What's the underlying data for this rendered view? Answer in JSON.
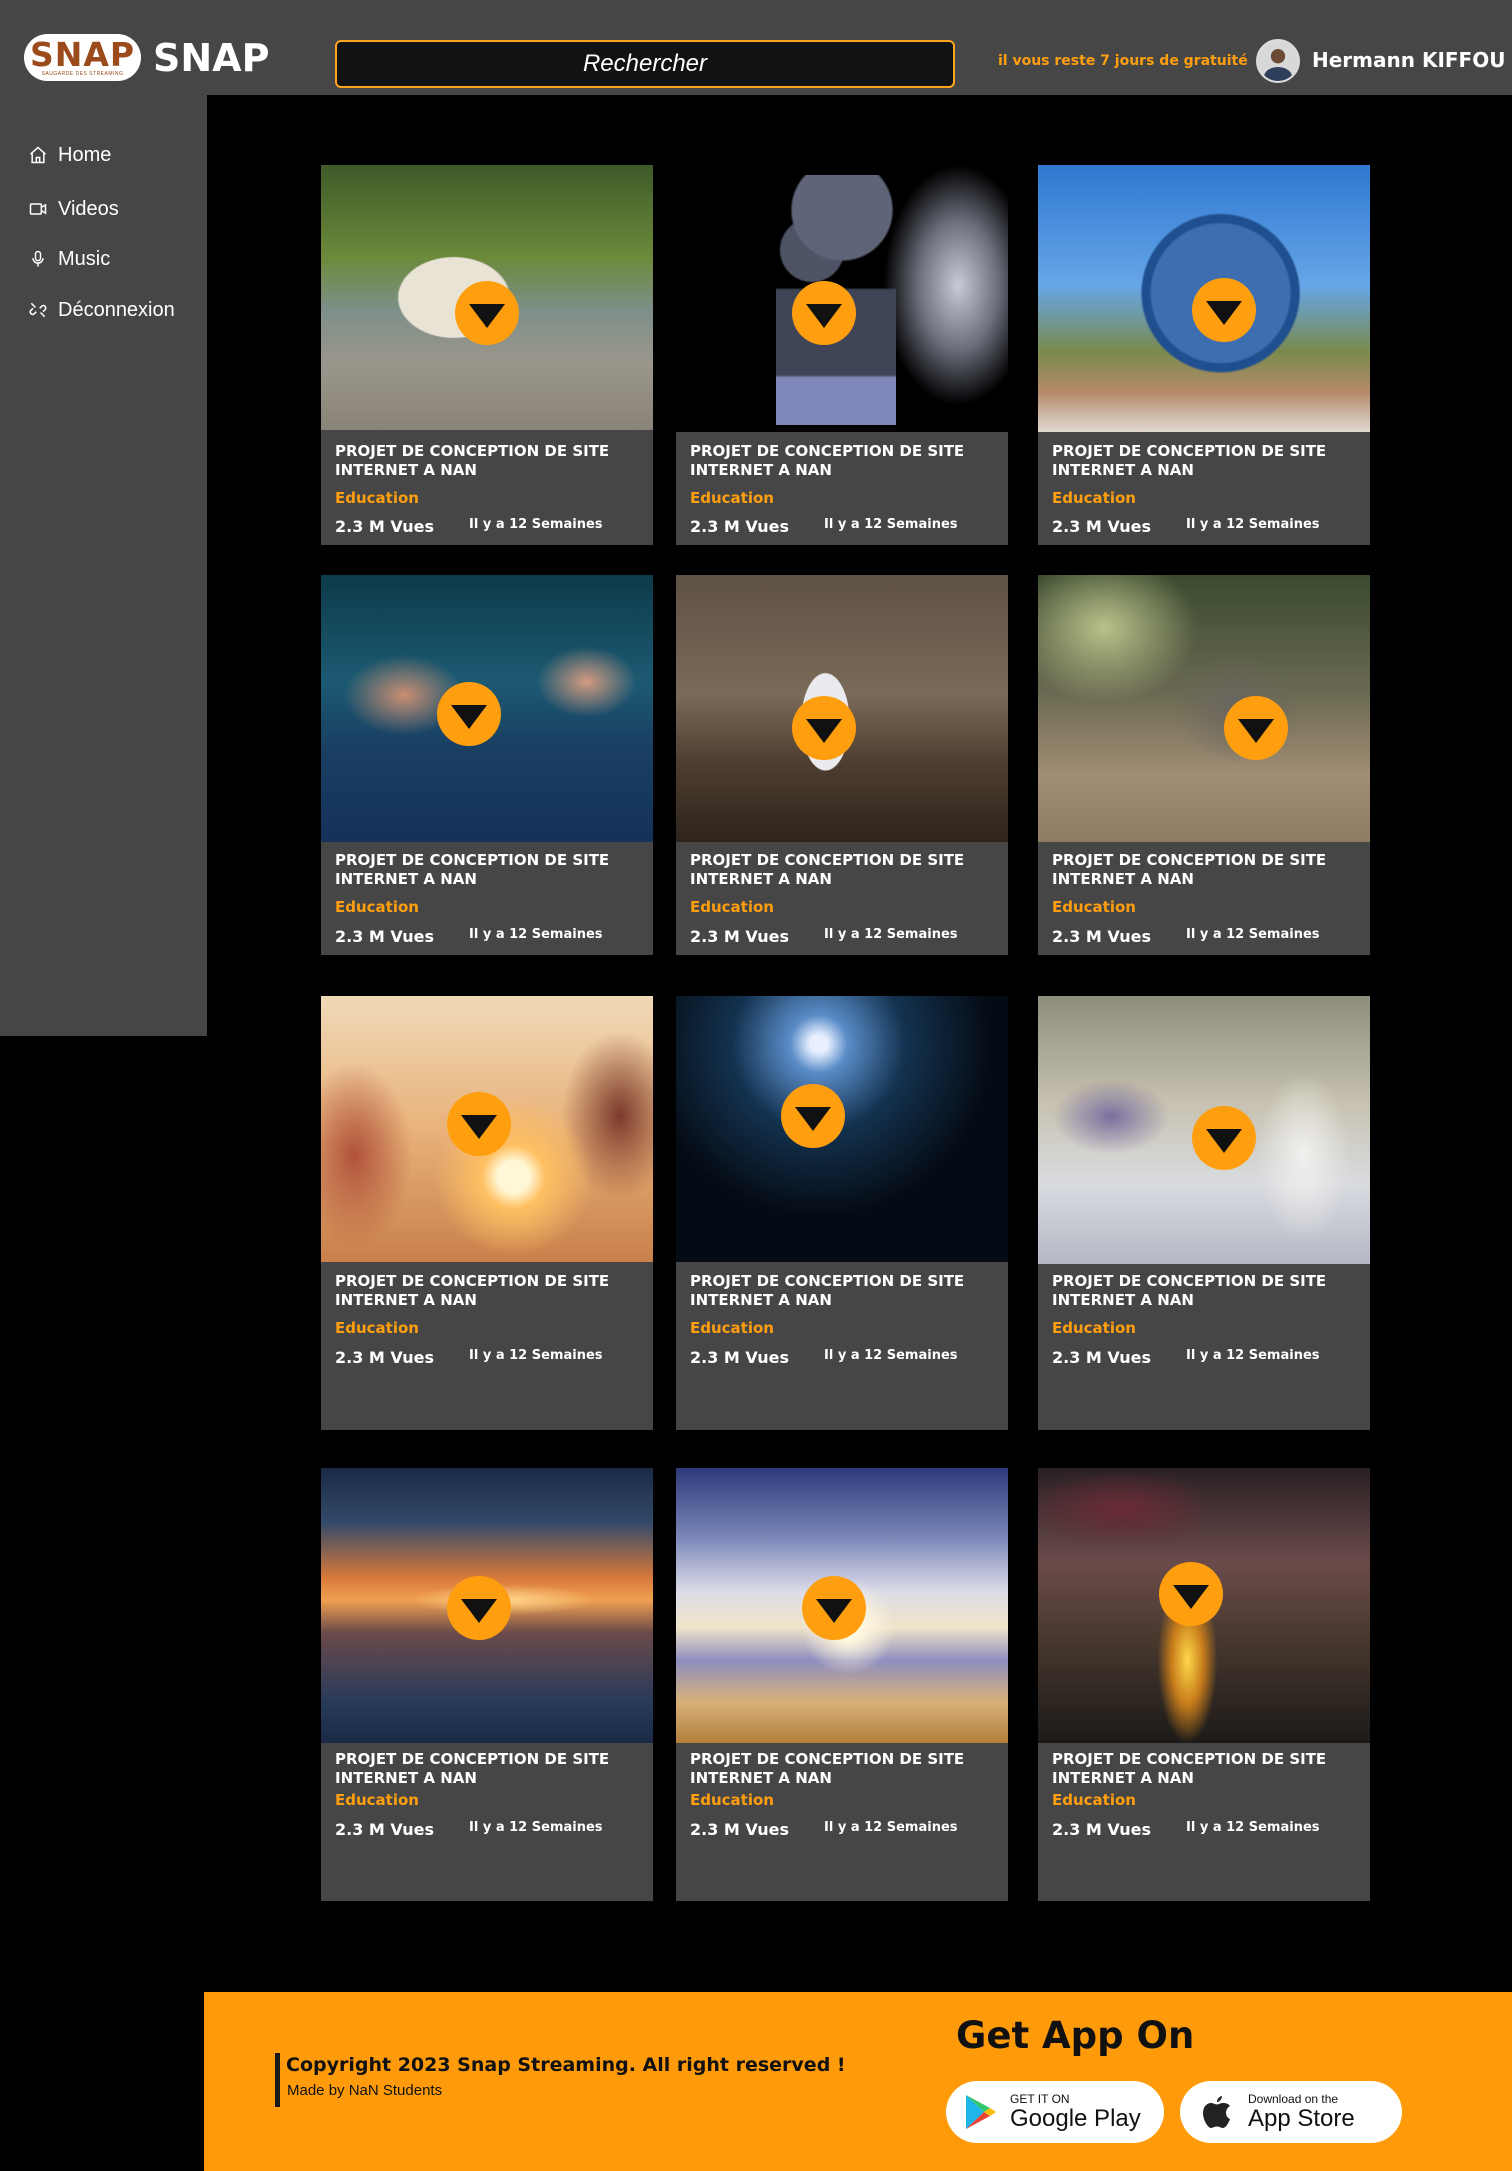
{
  "header": {
    "logo_text": "SNAP",
    "logo_tagline": "SAUGARDE DES STREAMING",
    "brand": "SNAP",
    "search_placeholder": "Rechercher",
    "trial_text": "il vous reste 7 jours de gratuité",
    "user_name": "Hermann KIFFOU"
  },
  "sidebar": {
    "items": [
      {
        "label": "Home",
        "icon": "home-icon"
      },
      {
        "label": "Videos",
        "icon": "video-icon"
      },
      {
        "label": "Music",
        "icon": "microphone-icon"
      },
      {
        "label": "Déconnexion",
        "icon": "unlink-icon"
      }
    ]
  },
  "videos": [
    {
      "title": "PROJET DE CONCEPTION DE SITE INTERNET A NAN",
      "category": "Education",
      "views": "2.3 M Vues",
      "date": "Il y a 12 Semaines",
      "thumbnail": "woman-reading-by-river"
    },
    {
      "title": "PROJET DE CONCEPTION DE SITE INTERNET A NAN",
      "category": "Education",
      "views": "2.3 M Vues",
      "date": "Il y a 12 Semaines",
      "thumbnail": "film-projector"
    },
    {
      "title": "PROJET DE CONCEPTION DE SITE INTERNET A NAN",
      "category": "Education",
      "views": "2.3 M Vues",
      "date": "Il y a 12 Semaines",
      "thumbnail": "universal-globe"
    },
    {
      "title": "PROJET DE CONCEPTION DE SITE INTERNET A NAN",
      "category": "Education",
      "views": "2.3 M Vues",
      "date": "Il y a 12 Semaines",
      "thumbnail": "cinema-audience"
    },
    {
      "title": "PROJET DE CONCEPTION DE SITE INTERNET A NAN",
      "category": "Education",
      "views": "2.3 M Vues",
      "date": "Il y a 12 Semaines",
      "thumbnail": "boy-in-classroom"
    },
    {
      "title": "PROJET DE CONCEPTION DE SITE INTERNET A NAN",
      "category": "Education",
      "views": "2.3 M Vues",
      "date": "Il y a 12 Semaines",
      "thumbnail": "baby-elephant"
    },
    {
      "title": "PROJET DE CONCEPTION DE SITE INTERNET A NAN",
      "category": "Education",
      "views": "2.3 M Vues",
      "date": "Il y a 12 Semaines",
      "thumbnail": "couple-heart-sunset"
    },
    {
      "title": "PROJET DE CONCEPTION DE SITE INTERNET A NAN",
      "category": "Education",
      "views": "2.3 M Vues",
      "date": "Il y a 12 Semaines",
      "thumbnail": "astronaut-space"
    },
    {
      "title": "PROJET DE CONCEPTION DE SITE INTERNET A NAN",
      "category": "Education",
      "views": "2.3 M Vues",
      "date": "Il y a 12 Semaines",
      "thumbnail": "woman-floating-castle"
    },
    {
      "title": "PROJET DE CONCEPTION DE SITE INTERNET A NAN",
      "category": "Education",
      "views": "2.3 M Vues",
      "date": "Il y a 12 Semaines",
      "thumbnail": "ocean-sunset"
    },
    {
      "title": "PROJET DE CONCEPTION DE SITE INTERNET A NAN",
      "category": "Education",
      "views": "2.3 M Vues",
      "date": "Il y a 12 Semaines",
      "thumbnail": "beach-waves"
    },
    {
      "title": "PROJET DE CONCEPTION DE SITE INTERNET A NAN",
      "category": "Education",
      "views": "2.3 M Vues",
      "date": "Il y a 12 Semaines",
      "thumbnail": "spaceships-city"
    }
  ],
  "footer": {
    "copyright": "Copyright 2023 Snap Streaming. All right reserved !",
    "made_by": "Made by NaN Students",
    "get_app": "Get App On",
    "google_small": "GET IT ON",
    "google_big": "Google Play",
    "apple_small": "Download on the",
    "apple_big": "App Store"
  },
  "colors": {
    "accent": "#ff9f0f",
    "panel": "#464646",
    "background": "#000000"
  }
}
